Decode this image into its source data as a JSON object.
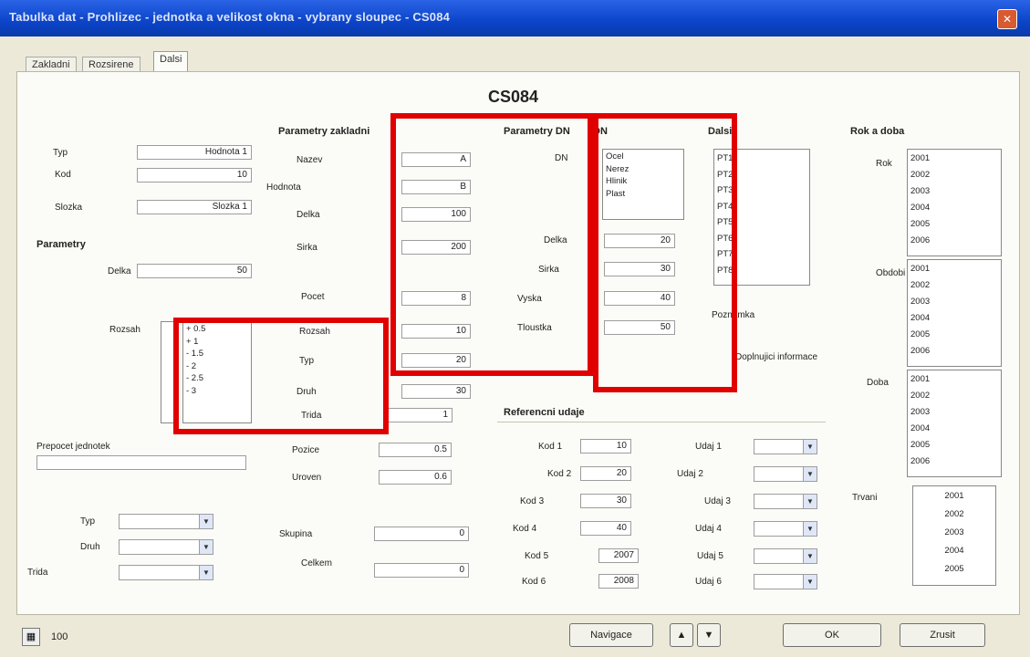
{
  "window": {
    "title": "Tabulka dat - Prohlizec - jednotka a velikost okna - vybrany sloupec - CS084",
    "close_icon": "close-icon"
  },
  "tabs": [
    "Zakladni",
    "Rozsirene",
    "Dalsi"
  ],
  "heading": "CS084",
  "left": {
    "fields": [
      {
        "label": "Typ",
        "value": "Hodnota 1"
      },
      {
        "label": "Kod",
        "value": "10"
      },
      {
        "label": "Slozka",
        "value": "Slozka 1"
      }
    ],
    "section2": {
      "title": "Parametry",
      "field_label": "Delka",
      "field_value": "50",
      "list_label": "Rozsah",
      "list_items": [
        "+ 0.5",
        "+ 1",
        "- 1.5",
        "- 2",
        "- 2.5",
        "- 3"
      ]
    },
    "wide_label": "Prepocet jednotek",
    "bottom_dropdowns": [
      {
        "label": "Typ"
      },
      {
        "label": "Druh"
      },
      {
        "label": "Trida"
      }
    ]
  },
  "col2": {
    "title": "Parametry zakladni",
    "rows": [
      {
        "label": "Nazev",
        "value": "A"
      },
      {
        "label": "Hodnota",
        "value": "B"
      },
      {
        "label": "Delka",
        "value": "100"
      },
      {
        "label": "Sirka",
        "value": "200"
      },
      {
        "label": "Pocet",
        "value": "8"
      },
      {
        "label": "Rozsah",
        "value": "10"
      },
      {
        "label": "Typ",
        "value": "20"
      },
      {
        "label": "Druh",
        "value": "30"
      },
      {
        "label": "Trida",
        "value": "1"
      },
      {
        "label": "Pozice",
        "value": "0.5"
      },
      {
        "label": "Uroven",
        "value": "0.6"
      },
      {
        "label": "Skupina",
        "value": "0"
      },
      {
        "label": "Celkem",
        "value": "0"
      }
    ]
  },
  "col3": {
    "title": "Parametry DN",
    "rows": [
      {
        "label": "DN",
        "value": ""
      },
      {
        "label": "Delka",
        "value": "20"
      },
      {
        "label": "Sirka",
        "value": "30"
      },
      {
        "label": "Vyska",
        "value": "40"
      },
      {
        "label": "Tloustka",
        "value": "50"
      }
    ]
  },
  "col4": {
    "title": "DN",
    "list": [
      "Ocel",
      "Nerez",
      "Hlinik",
      "Plast"
    ]
  },
  "col5": {
    "title": "Dalsi",
    "list": [
      "PT1",
      "PT2",
      "PT3",
      "PT4",
      "PT5",
      "PT6",
      "PT7",
      "PT8"
    ],
    "label1": "Poznamka",
    "label2": "Doplnujici informace"
  },
  "ref": {
    "title": "Referencni udaje",
    "left": [
      {
        "label": "Kod 1",
        "value": "10"
      },
      {
        "label": "Kod 2",
        "value": "20"
      },
      {
        "label": "Kod 3",
        "value": "30"
      },
      {
        "label": "Kod 4",
        "value": "40"
      },
      {
        "label": "Kod 5",
        "value": "2007"
      },
      {
        "label": "Kod 6",
        "value": "2008"
      }
    ],
    "right": [
      "Udaj 1",
      "Udaj 2",
      "Udaj 3",
      "Udaj 4",
      "Udaj 5",
      "Udaj 6"
    ]
  },
  "right": {
    "title": "Rok a doba",
    "groups": [
      {
        "label": "Rok",
        "items": [
          "2001",
          "2002",
          "2003",
          "2004",
          "2005",
          "2006"
        ]
      },
      {
        "label": "Obdobi",
        "items": [
          "2001",
          "2002",
          "2003",
          "2004",
          "2005",
          "2006"
        ]
      },
      {
        "label": "Doba",
        "items": [
          "2001",
          "2002",
          "2003",
          "2004",
          "2005",
          "2006"
        ]
      },
      {
        "label": "Trvani",
        "items": [
          "2001",
          "2002",
          "2003",
          "2004",
          "2005"
        ]
      }
    ]
  },
  "footer": {
    "status": "100",
    "nav_label": "Navigace",
    "up": "▲",
    "down": "▼",
    "ok": "OK",
    "cancel": "Zrusit"
  },
  "colors": {
    "highlight": "#e00000",
    "titlebar": "#0b44c9"
  }
}
